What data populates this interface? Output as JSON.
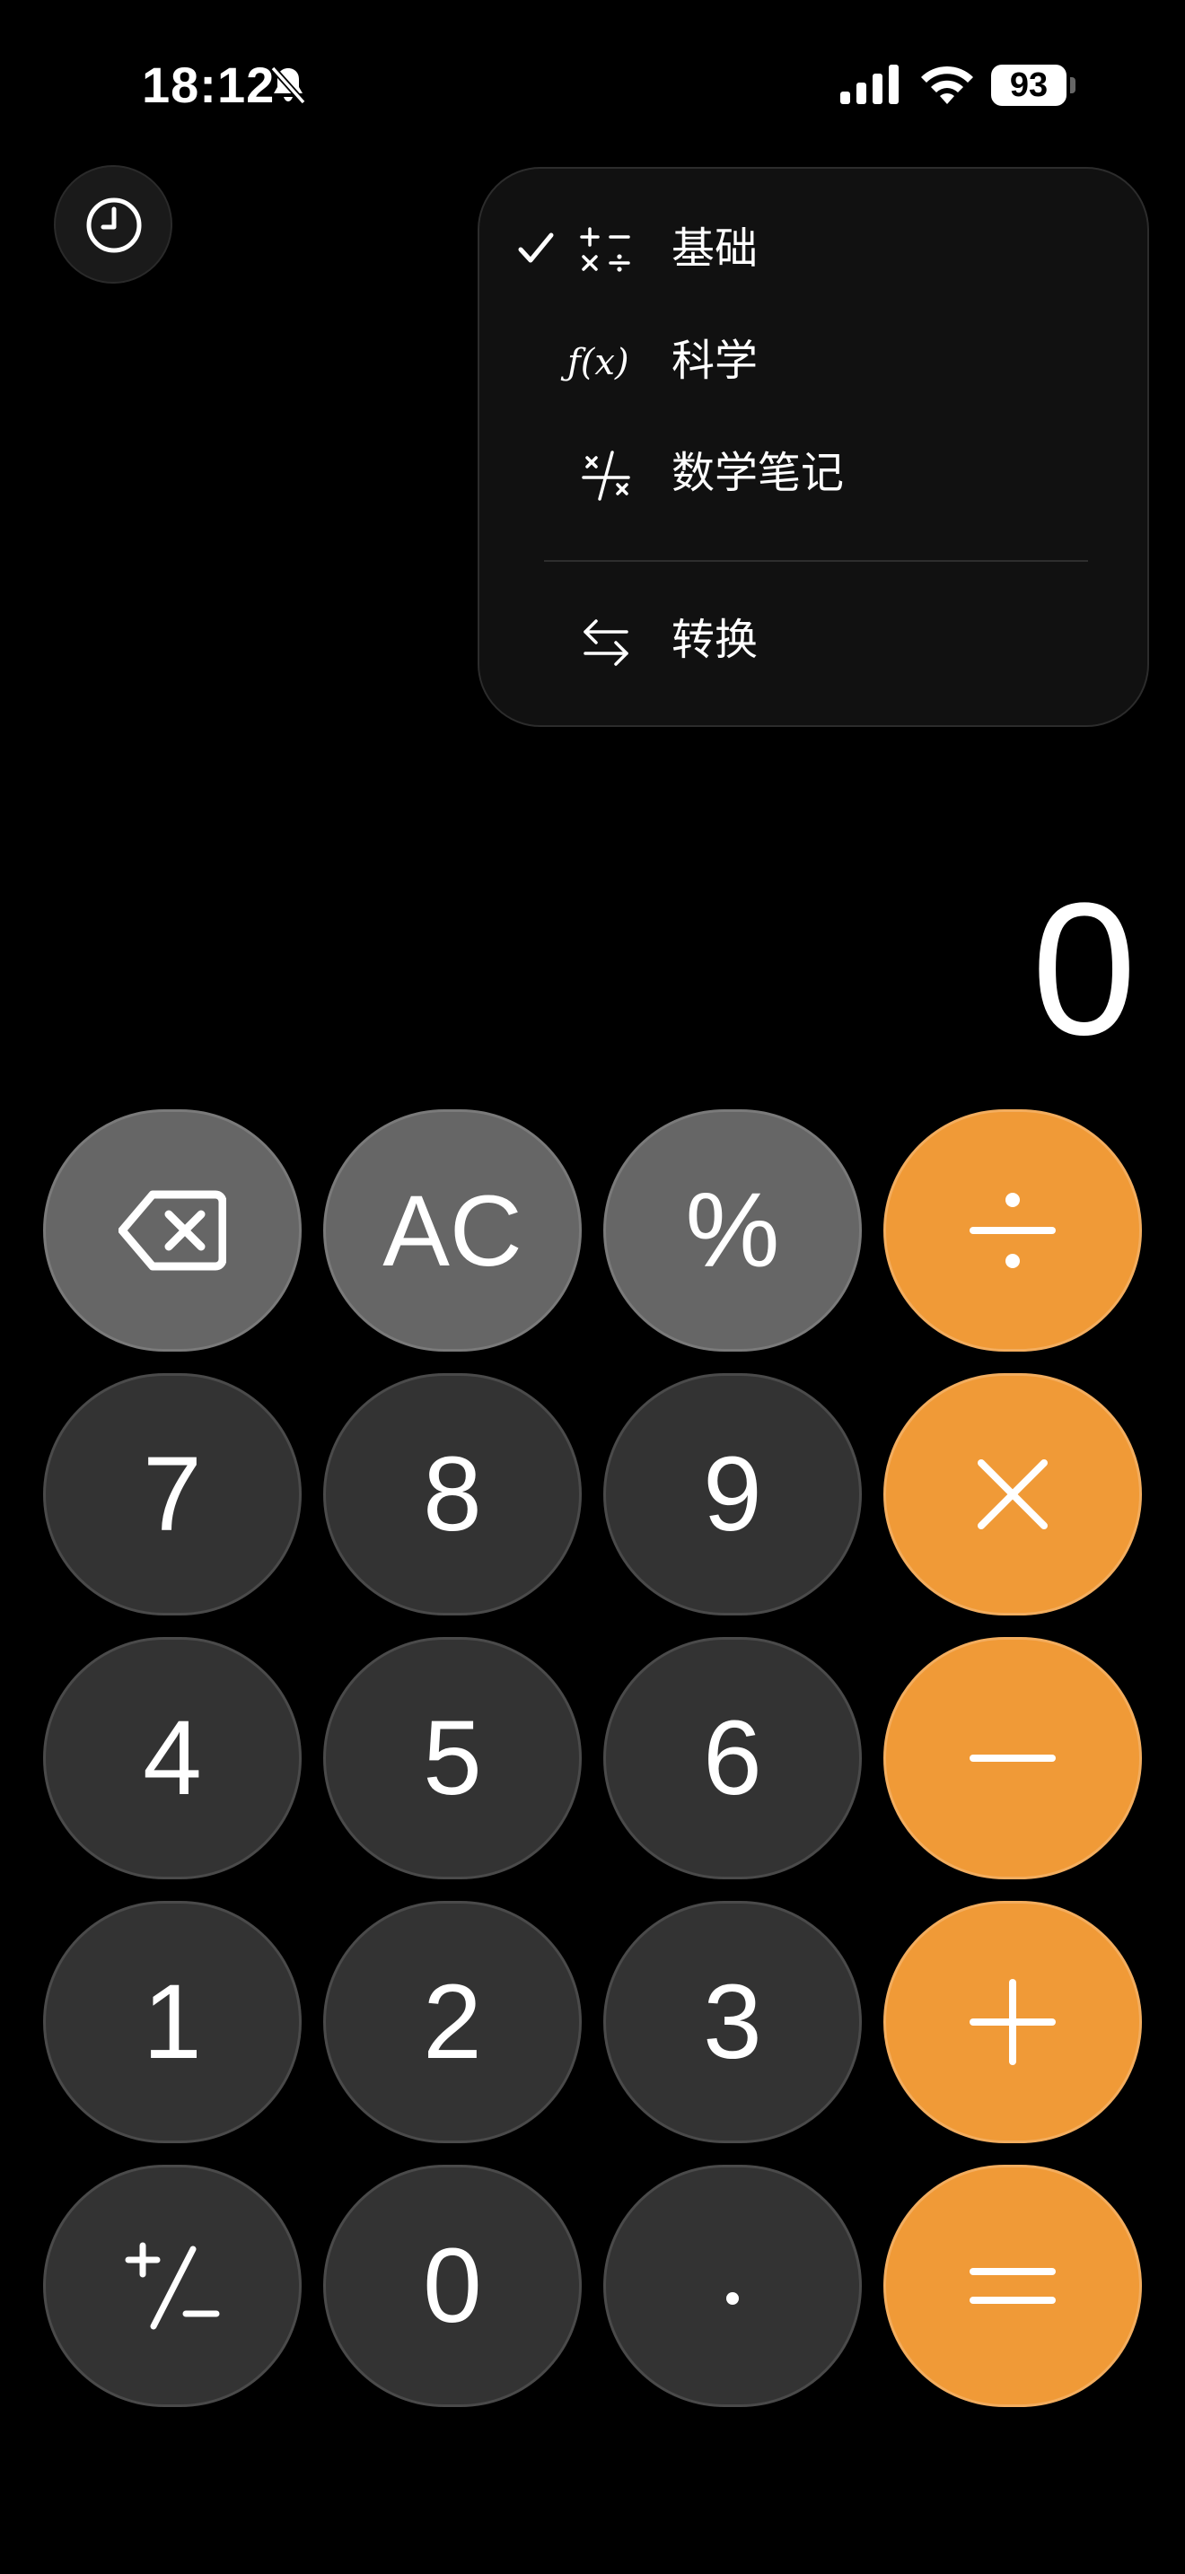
{
  "status_bar": {
    "time": "18:12",
    "battery": "93",
    "icons": [
      "bell-slash-icon",
      "cellular-signal-icon",
      "wifi-icon",
      "battery-icon"
    ]
  },
  "menu": {
    "items": [
      {
        "label": "基础",
        "icon": "basic-ops-icon",
        "checked": true
      },
      {
        "label": "科学",
        "icon": "function-icon",
        "icon_text": "ƒ(x)",
        "checked": false
      },
      {
        "label": "数学笔记",
        "icon": "math-notes-icon",
        "checked": false
      },
      {
        "label": "转换",
        "icon": "convert-arrows-icon",
        "checked": false
      }
    ]
  },
  "display": {
    "value": "0"
  },
  "keypad": {
    "rows": [
      [
        "backspace",
        "AC",
        "%",
        "÷"
      ],
      [
        "7",
        "8",
        "9",
        "×"
      ],
      [
        "4",
        "5",
        "6",
        "−"
      ],
      [
        "1",
        "2",
        "3",
        "+"
      ],
      [
        "+/−",
        "0",
        ".",
        "="
      ]
    ]
  },
  "colors": {
    "operator": "#F09A37",
    "digit": "#333333",
    "function": "#666666",
    "background": "#000000"
  }
}
